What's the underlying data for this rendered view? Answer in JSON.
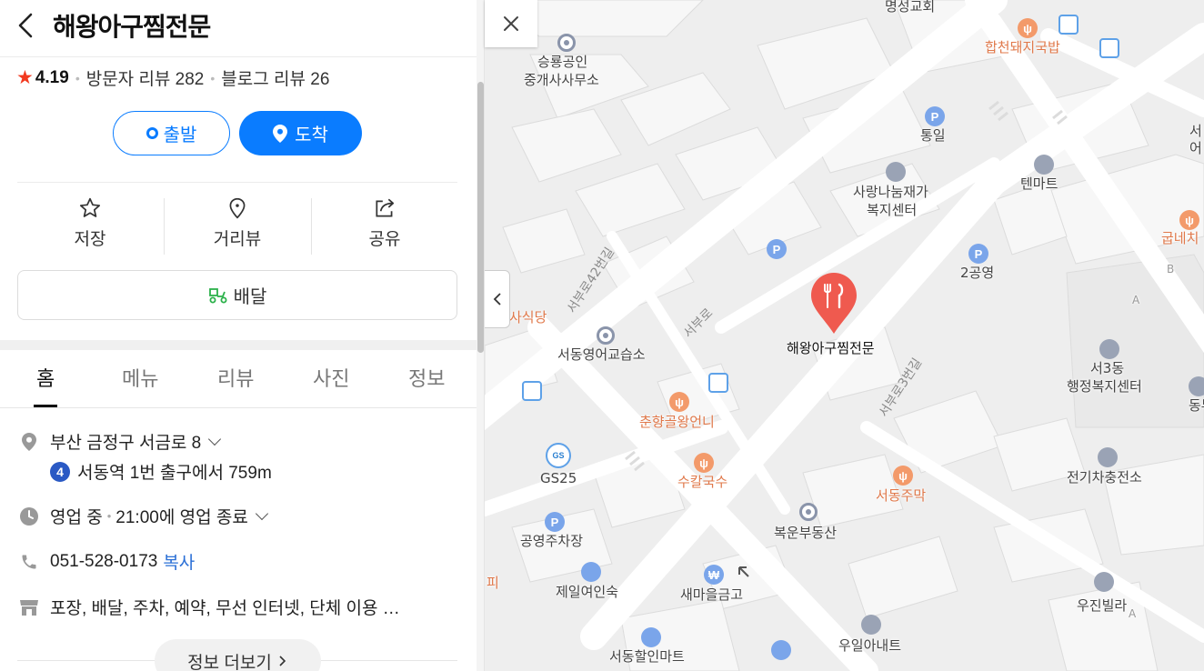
{
  "header": {
    "title": "해왕아구찜전문"
  },
  "rating": {
    "score": "4.19",
    "visitor_reviews": "방문자 리뷰 282",
    "blog_reviews": "블로그 리뷰 26"
  },
  "route": {
    "depart_label": "출발",
    "arrive_label": "도착"
  },
  "actions": {
    "save_label": "저장",
    "streetview_label": "거리뷰",
    "share_label": "공유"
  },
  "delivery": {
    "label": "배달"
  },
  "tabs": [
    "홈",
    "메뉴",
    "리뷰",
    "사진",
    "정보"
  ],
  "info": {
    "address": "부산 금정구 서금로 8",
    "subway_line": "4",
    "subway_text": "서동역 1번 출구에서 759m",
    "hours": "영업 중",
    "hours_detail": "21:00에 영업 종료",
    "phone": "051-528-0173",
    "copy_label": "복사",
    "amenities": "포장, 배달, 주차, 예약, 무선 인터넷, 단체 이용 …",
    "more_label": "정보 더보기"
  },
  "colors": {
    "accent": "#0a7cff",
    "star": "#f2391f",
    "marker": "#ef5a4f",
    "food_label": "#e0784a"
  },
  "map": {
    "selected_label": "해왕아구찜전문",
    "labels": {
      "church": "명성교회",
      "hapcheon": "합천돼지국밥",
      "realty1a": "승룡공인",
      "realty1b": "중개사사무소",
      "tongil": "통일",
      "welfare_a": "사랑나눔재가",
      "welfare_b": "복지센터",
      "tenmart": "텐마트",
      "gubne": "굽네치",
      "parking2": "2공영",
      "sikdang": "사식당",
      "english": "서동영어교습소",
      "chunhyang": "춘향골왕언니",
      "gs25": "GS25",
      "kalguksu": "수칼국수",
      "seodong_jumak": "서동주막",
      "bokun": "복운부동산",
      "seo3dong_a": "서3동",
      "seo3dong_b": "행정복지센터",
      "dongbu": "동부고",
      "ev": "전기차충전소",
      "parking_public": "공영주차장",
      "jeil": "제일여인숙",
      "saemaeul": "새마을금고",
      "ujin": "우진빌라",
      "uil": "우일아내트",
      "seodong_mart": "서동할인마트",
      "pi": "피",
      "seoeo": "서\n어",
      "b_letter": "B",
      "a_letter": "A",
      "a_letter2": "A",
      "street1": "서부로42번길",
      "street2": "서부로",
      "street3": "서부로3번길"
    }
  }
}
